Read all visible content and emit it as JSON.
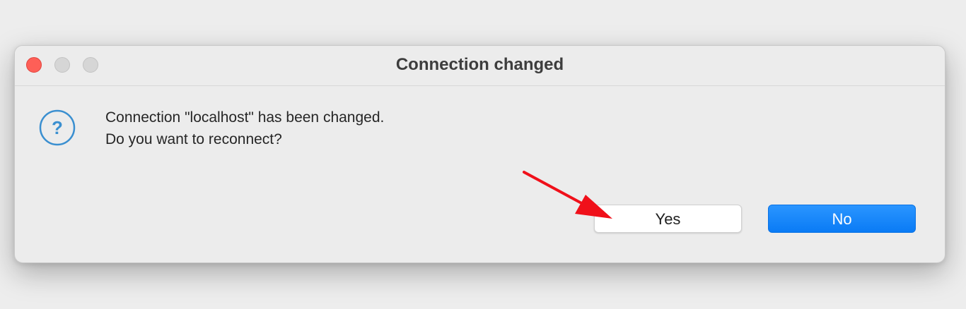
{
  "window": {
    "title": "Connection changed",
    "controls": [
      "close",
      "minimize",
      "maximize"
    ]
  },
  "dialog": {
    "icon": "question-icon",
    "message_line1": "Connection \"localhost\" has been changed.",
    "message_line2": "Do you want to reconnect?"
  },
  "buttons": {
    "yes_label": "Yes",
    "no_label": "No"
  },
  "colors": {
    "accent": "#0a7bf5",
    "close": "#fe5f57",
    "annotation_arrow": "#f0101a",
    "icon": "#3a8fd0"
  }
}
